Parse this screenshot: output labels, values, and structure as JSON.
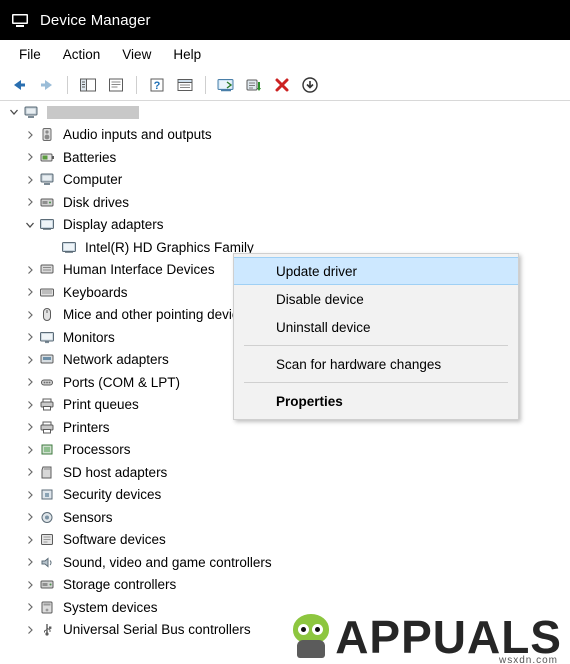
{
  "window": {
    "title": "Device Manager",
    "icon": "device-manager-icon"
  },
  "menubar": {
    "items": [
      {
        "label": "File",
        "name": "menu-file"
      },
      {
        "label": "Action",
        "name": "menu-action"
      },
      {
        "label": "View",
        "name": "menu-view"
      },
      {
        "label": "Help",
        "name": "menu-help"
      }
    ]
  },
  "toolbar": {
    "buttons": [
      {
        "name": "back-button",
        "icon": "back-arrow-icon"
      },
      {
        "name": "forward-button",
        "icon": "forward-arrow-icon"
      },
      {
        "name": "show-hide-console-tree-button",
        "icon": "console-tree-icon"
      },
      {
        "name": "properties-button",
        "icon": "properties-icon"
      },
      {
        "name": "help-button",
        "icon": "question-mark-icon"
      },
      {
        "name": "view-details-button",
        "icon": "details-icon"
      },
      {
        "name": "scan-hardware-changes-button",
        "icon": "monitor-scan-icon"
      },
      {
        "name": "update-driver-button",
        "icon": "update-driver-icon"
      },
      {
        "name": "uninstall-device-button",
        "icon": "red-x-icon"
      },
      {
        "name": "disable-device-button",
        "icon": "down-arrow-circle-icon"
      }
    ]
  },
  "tree": {
    "root": {
      "label": "",
      "redacted": true,
      "expanded": true,
      "icon": "computer-icon"
    },
    "nodes": [
      {
        "label": "Audio inputs and outputs",
        "icon": "speaker-icon",
        "expanded": false,
        "depth": 1
      },
      {
        "label": "Batteries",
        "icon": "battery-icon",
        "expanded": false,
        "depth": 1
      },
      {
        "label": "Computer",
        "icon": "computer-icon",
        "expanded": false,
        "depth": 1
      },
      {
        "label": "Disk drives",
        "icon": "disk-drive-icon",
        "expanded": false,
        "depth": 1
      },
      {
        "label": "Display adapters",
        "icon": "display-adapter-icon",
        "expanded": true,
        "depth": 1
      },
      {
        "label": "Intel(R) HD Graphics Family",
        "icon": "display-adapter-icon",
        "expanded": null,
        "depth": 2,
        "selected": true
      },
      {
        "label": "Human Interface Devices",
        "icon": "hid-icon",
        "expanded": false,
        "depth": 1
      },
      {
        "label": "Keyboards",
        "icon": "keyboard-icon",
        "expanded": false,
        "depth": 1
      },
      {
        "label": "Mice and other pointing devices",
        "icon": "mouse-icon",
        "expanded": false,
        "depth": 1
      },
      {
        "label": "Monitors",
        "icon": "monitor-icon",
        "expanded": false,
        "depth": 1
      },
      {
        "label": "Network adapters",
        "icon": "network-adapter-icon",
        "expanded": false,
        "depth": 1
      },
      {
        "label": "Ports (COM & LPT)",
        "icon": "port-icon",
        "expanded": false,
        "depth": 1
      },
      {
        "label": "Print queues",
        "icon": "printer-icon",
        "expanded": false,
        "depth": 1
      },
      {
        "label": "Printers",
        "icon": "printer-icon",
        "expanded": false,
        "depth": 1
      },
      {
        "label": "Processors",
        "icon": "processor-icon",
        "expanded": false,
        "depth": 1
      },
      {
        "label": "SD host adapters",
        "icon": "sd-card-icon",
        "expanded": false,
        "depth": 1
      },
      {
        "label": "Security devices",
        "icon": "security-device-icon",
        "expanded": false,
        "depth": 1
      },
      {
        "label": "Sensors",
        "icon": "sensor-icon",
        "expanded": false,
        "depth": 1
      },
      {
        "label": "Software devices",
        "icon": "software-device-icon",
        "expanded": false,
        "depth": 1
      },
      {
        "label": "Sound, video and game controllers",
        "icon": "sound-controller-icon",
        "expanded": false,
        "depth": 1
      },
      {
        "label": "Storage controllers",
        "icon": "storage-controller-icon",
        "expanded": false,
        "depth": 1
      },
      {
        "label": "System devices",
        "icon": "system-device-icon",
        "expanded": false,
        "depth": 1
      },
      {
        "label": "Universal Serial Bus controllers",
        "icon": "usb-controller-icon",
        "expanded": false,
        "depth": 1
      }
    ]
  },
  "context_menu": {
    "items": [
      {
        "label": "Update driver",
        "name": "ctx-update-driver",
        "highlighted": true
      },
      {
        "label": "Disable device",
        "name": "ctx-disable-device",
        "highlighted": false
      },
      {
        "label": "Uninstall device",
        "name": "ctx-uninstall-device",
        "highlighted": false
      },
      {
        "label": "Scan for hardware changes",
        "name": "ctx-scan-hardware-changes",
        "highlighted": false
      },
      {
        "label": "Properties",
        "name": "ctx-properties",
        "highlighted": false,
        "bold": true
      }
    ]
  },
  "watermark": {
    "text": "APPUALS",
    "sub": "wsxdn.com"
  },
  "colors": {
    "titlebar_bg": "#000000",
    "selection": "#cde8ff",
    "accent_green": "#8dc63f",
    "red": "#cc2222"
  }
}
